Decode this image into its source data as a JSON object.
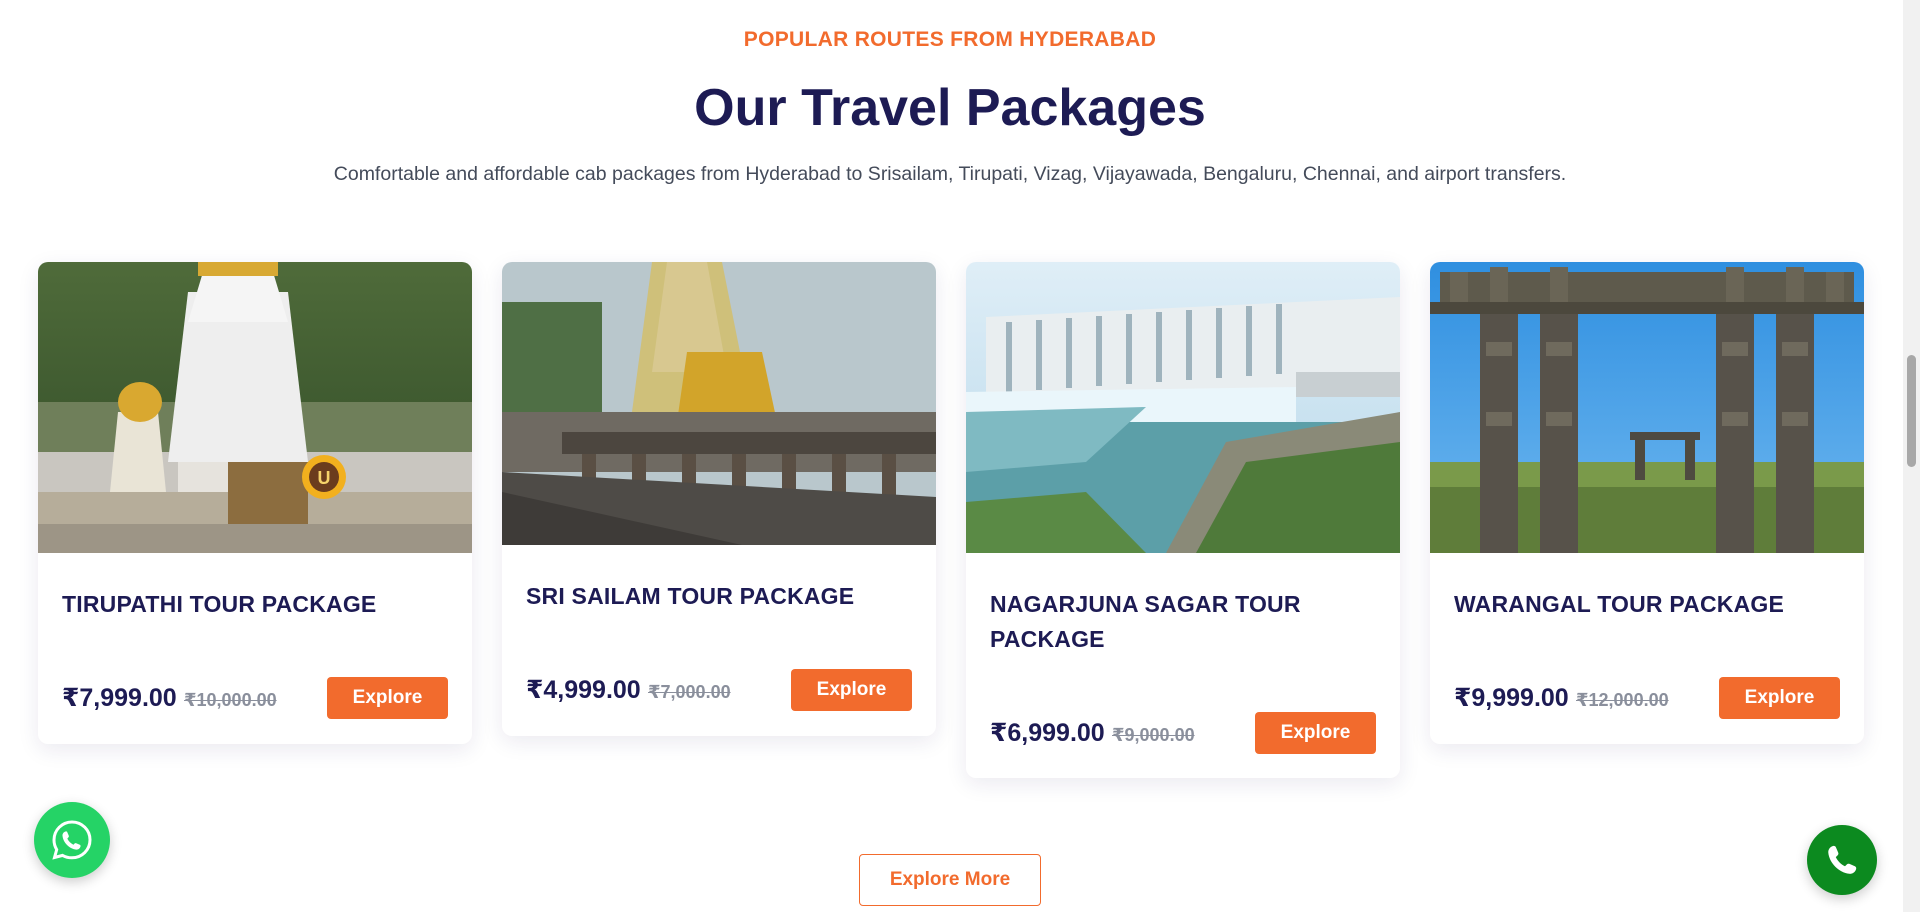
{
  "section": {
    "eyebrow": "POPULAR ROUTES FROM HYDERABAD",
    "title": "Our Travel Packages",
    "subtitle": "Comfortable and affordable cab packages from Hyderabad to Srisailam, Tirupati, Vizag, Vijayawada, Bengaluru, Chennai, and airport transfers."
  },
  "packages": [
    {
      "title": "TIRUPATHI TOUR PACKAGE",
      "price": "₹7,999.00",
      "old_price": "₹10,000.00",
      "button": "Explore",
      "image": "tirupati-temple-photo"
    },
    {
      "title": "SRI SAILAM TOUR PACKAGE",
      "price": "₹4,999.00",
      "old_price": "₹7,000.00",
      "button": "Explore",
      "image": "srisailam-temple-photo"
    },
    {
      "title": "NAGARJUNA SAGAR TOUR PACKAGE",
      "price": "₹6,999.00",
      "old_price": "₹9,000.00",
      "button": "Explore",
      "image": "nagarjuna-sagar-dam-photo"
    },
    {
      "title": "WARANGAL TOUR PACKAGE",
      "price": "₹9,999.00",
      "old_price": "₹12,000.00",
      "button": "Explore",
      "image": "warangal-kakatiya-arch-photo"
    }
  ],
  "explore_more": "Explore More",
  "floating": {
    "whatsapp_icon": "whatsapp-icon",
    "call_icon": "phone-icon"
  },
  "colors": {
    "accent": "#f26b2d",
    "heading": "#1d1b54",
    "whatsapp": "#25d366",
    "call": "#0c8a1f"
  }
}
